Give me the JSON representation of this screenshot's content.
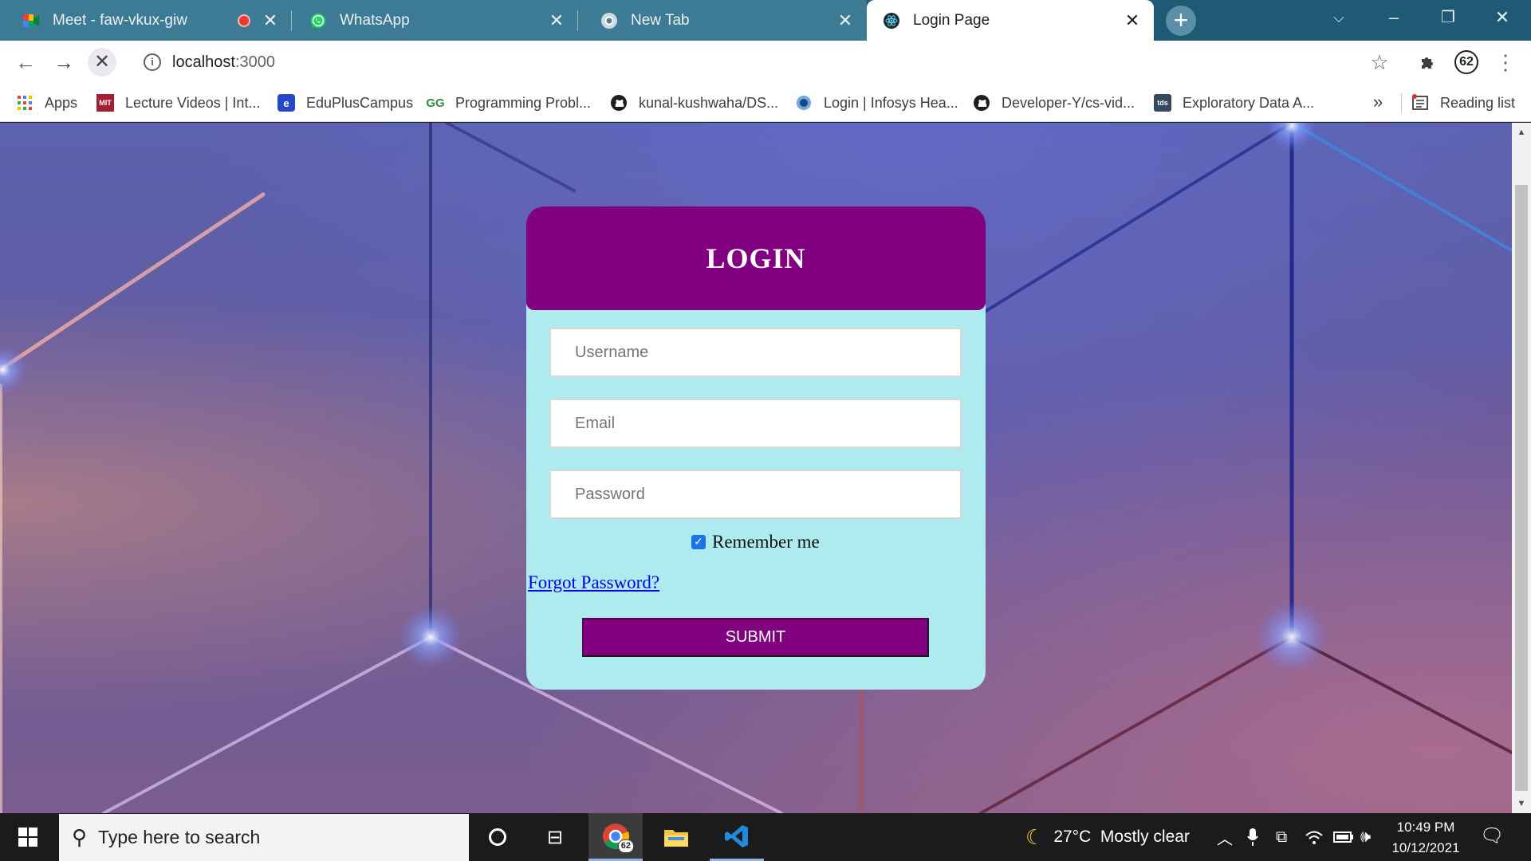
{
  "browser": {
    "tabs": [
      {
        "title": "Meet - faw-vkux-giw",
        "icon": "google-meet-icon",
        "recording": true
      },
      {
        "title": "WhatsApp",
        "icon": "whatsapp-icon"
      },
      {
        "title": "New Tab",
        "icon": "chrome-icon"
      },
      {
        "title": "Login Page",
        "icon": "react-icon",
        "active": true
      }
    ],
    "url_host": "localhost",
    "url_port": ":3000",
    "profile_count": "62",
    "bookmarks": [
      {
        "label": "Apps",
        "icon": "apps-grid-icon"
      },
      {
        "label": "Lecture Videos | Int...",
        "icon": "mit-ocw-icon"
      },
      {
        "label": "EduPlusCampus",
        "icon": "eduplus-icon"
      },
      {
        "label": "Programming Probl...",
        "icon": "geeksforgeeks-icon"
      },
      {
        "label": "kunal-kushwaha/DS...",
        "icon": "github-icon"
      },
      {
        "label": "Login | Infosys Hea...",
        "icon": "infosys-icon"
      },
      {
        "label": "Developer-Y/cs-vid...",
        "icon": "github-icon"
      },
      {
        "label": "Exploratory Data A...",
        "icon": "tds-icon"
      }
    ],
    "reading_list": "Reading list"
  },
  "login": {
    "title": "LOGIN",
    "username_placeholder": "Username",
    "email_placeholder": "Email",
    "password_placeholder": "Password",
    "remember_label": "Remember me",
    "remember_checked": true,
    "forgot_link": "Forgot Password?",
    "submit_label": "SUBMIT"
  },
  "taskbar": {
    "search_placeholder": "Type here to search",
    "chrome_badge": "62",
    "weather": "27°C  Mostly clear",
    "time": "10:49 PM",
    "date": "10/12/2021"
  },
  "colors": {
    "tab_strip": "#1f5a75",
    "card_bg": "#aeebee",
    "card_header": "#800080",
    "submit_bg": "#800080",
    "link": "#0000ee"
  }
}
